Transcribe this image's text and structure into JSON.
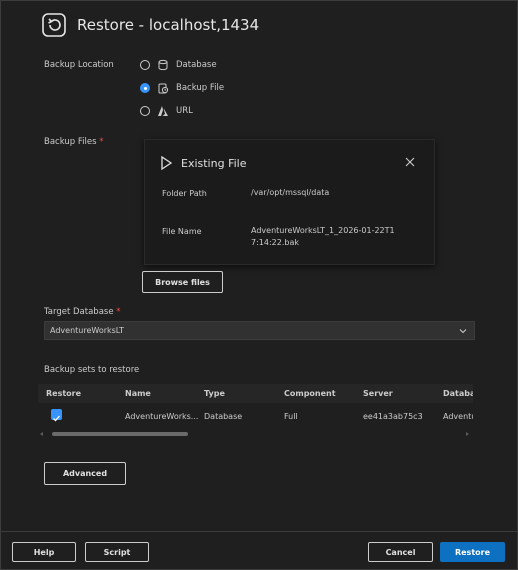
{
  "dialog": {
    "title": "Restore - localhost,1434"
  },
  "backup_location": {
    "label": "Backup Location",
    "options": [
      {
        "label": "Database",
        "icon": "database-icon",
        "selected": false
      },
      {
        "label": "Backup File",
        "icon": "backup-file-icon",
        "selected": true
      },
      {
        "label": "URL",
        "icon": "azure-icon",
        "selected": false
      }
    ]
  },
  "backup_files": {
    "label": "Backup Files",
    "required_mark": "*",
    "existing_file": {
      "title": "Existing File",
      "folder_path_label": "Folder Path",
      "folder_path_value": "/var/opt/mssql/data",
      "file_name_label": "File Name",
      "file_name_value": "AdventureWorksLT_1_2026-01-22T17:14:22.bak"
    },
    "browse_label": "Browse files"
  },
  "target_database": {
    "label": "Target Database",
    "required_mark": "*",
    "value": "AdventureWorksLT"
  },
  "backup_sets": {
    "heading": "Backup sets to restore",
    "columns": [
      "Restore",
      "Name",
      "Type",
      "Component",
      "Server",
      "Databa"
    ],
    "rows": [
      {
        "restore": true,
        "name": "AdventureWorks...",
        "type": "Database",
        "component": "Full",
        "server": "ee41a3ab75c3",
        "database": "Adventu"
      }
    ]
  },
  "advanced_label": "Advanced",
  "footer": {
    "help_label": "Help",
    "script_label": "Script",
    "cancel_label": "Cancel",
    "restore_label": "Restore"
  },
  "colors": {
    "background": "#1f1f1f",
    "accent": "#0e70c0",
    "required": "#f14c4c"
  }
}
